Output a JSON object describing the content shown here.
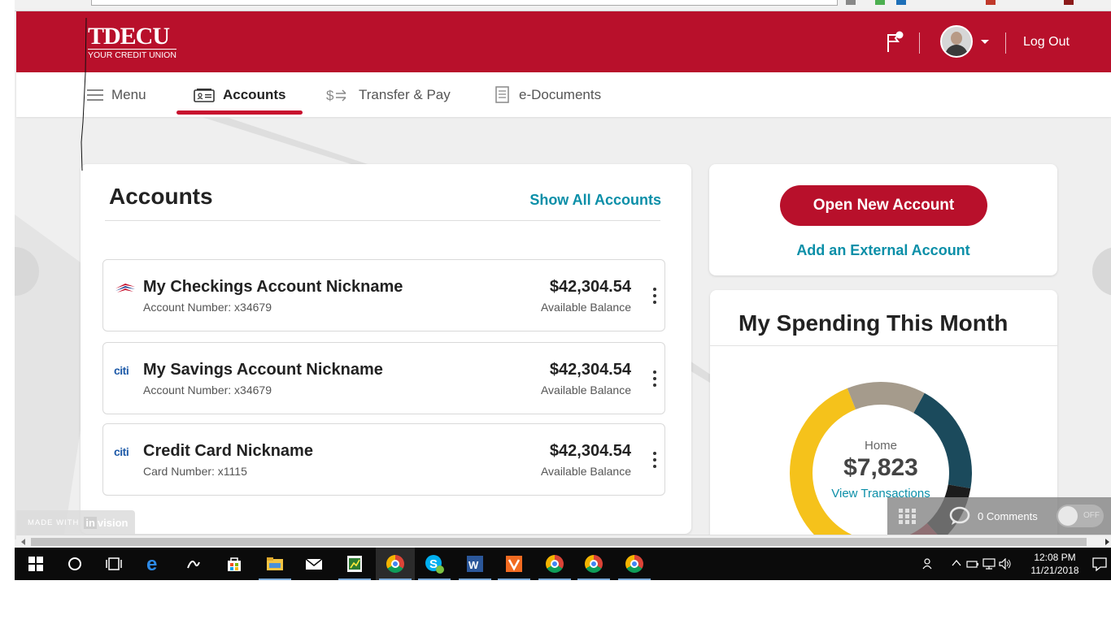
{
  "header": {
    "brand": "TDECU",
    "tagline": "YOUR CREDIT UNION",
    "logout_label": "Log Out"
  },
  "nav": {
    "menu": "Menu",
    "accounts": "Accounts",
    "transfer": "Transfer & Pay",
    "documents": "e-Documents"
  },
  "accounts": {
    "title": "Accounts",
    "show_all": "Show All Accounts",
    "items": [
      {
        "name": "My Checkings Account Nickname",
        "number": "Account Number:  x34679",
        "balance": "$42,304.54",
        "balance_label": "Available Balance",
        "bank": "bank-of-america-icon"
      },
      {
        "name": "My Savings Account Nickname",
        "number": "Account Number:  x34679",
        "balance": "$42,304.54",
        "balance_label": "Available Balance",
        "bank": "citi-icon"
      },
      {
        "name": "Credit Card Nickname",
        "number": "Card Number:  x1115",
        "balance": "$42,304.54",
        "balance_label": "Available Balance",
        "bank": "citi-icon"
      }
    ]
  },
  "actions": {
    "open_new": "Open New Account",
    "add_external": "Add an External Account"
  },
  "spending": {
    "title": "My Spending This Month",
    "center_label": "Home",
    "center_amount": "$7,823",
    "link": "View Transactions",
    "segment_colors": [
      "#1b4a5c",
      "#1c1c1c",
      "#c0303f",
      "#3fb1d6",
      "#b28b2a",
      "#f5c21b",
      "#a59b8c"
    ],
    "segment_shares": [
      0.17,
      0.09,
      0.06,
      0.04,
      0.05,
      0.33,
      0.12
    ]
  },
  "invision": {
    "made_with": "MADE WITH",
    "logo_in": "in",
    "logo_rest": "vision",
    "comments": "0 Comments",
    "toggle": "OFF"
  },
  "taskbar": {
    "time": "12:08 PM",
    "date": "11/21/2018"
  },
  "colors": {
    "brand_red": "#b8102b",
    "link_teal": "#0b8fa8"
  }
}
